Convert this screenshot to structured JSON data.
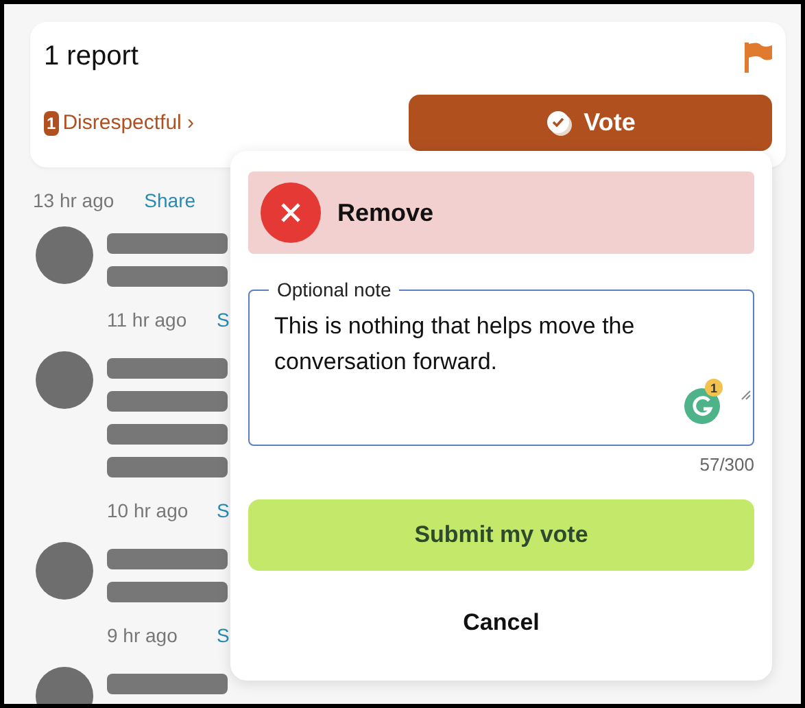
{
  "report": {
    "title": "1 report",
    "reason_count": "1",
    "reason": "Disrespectful ›",
    "vote_button": "Vote"
  },
  "meta": {
    "time": "13 hr ago",
    "share": "Share"
  },
  "comments": [
    {
      "redacted_lines": [
        {
          "kind": "line"
        },
        {
          "kind": "line"
        }
      ],
      "time": "11 hr ago",
      "share": "S"
    },
    {
      "redacted_lines": [
        {
          "kind": "line"
        },
        {
          "kind": "line"
        },
        {
          "kind": "line"
        },
        {
          "kind": "line"
        }
      ],
      "time": "10 hr ago",
      "share": "S"
    },
    {
      "redacted_lines": [
        {
          "kind": "line"
        },
        {
          "kind": "line"
        }
      ],
      "time": "9 hr ago",
      "share": "S"
    },
    {
      "redacted_lines": [
        {
          "kind": "line"
        }
      ]
    }
  ],
  "vote_panel": {
    "option": {
      "label": "Remove",
      "selected": true
    },
    "note": {
      "label": "Optional note",
      "value": "This is nothing that helps move the conversation forward.",
      "counter": "57/300",
      "grammar_badge": "1"
    },
    "submit": "Submit my vote",
    "cancel": "Cancel"
  }
}
